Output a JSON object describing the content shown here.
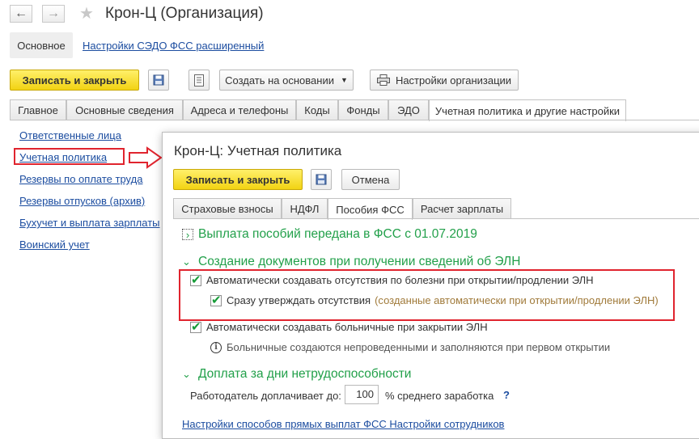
{
  "window": {
    "title": "Крон-Ц (Организация)",
    "back_icon": "arrow-left-icon",
    "forward_icon": "arrow-right-icon",
    "favorite_icon": "star-icon"
  },
  "subtabs": {
    "main_label": "Основное",
    "settings_link": "Настройки СЭДО ФСС расширенный"
  },
  "toolbar": {
    "save_close": "Записать и закрыть",
    "create_based": "Создать на основании",
    "org_settings": "Настройки организации"
  },
  "tabs": [
    {
      "label": "Главное"
    },
    {
      "label": "Основные сведения"
    },
    {
      "label": "Адреса и телефоны"
    },
    {
      "label": "Коды"
    },
    {
      "label": "Фонды"
    },
    {
      "label": "ЭДО"
    },
    {
      "label": "Учетная политика и другие настройки"
    }
  ],
  "left_nav": [
    {
      "label": "Ответственные лица"
    },
    {
      "label": "Учетная политика"
    },
    {
      "label": "Резервы по оплате труда"
    },
    {
      "label": "Резервы отпусков (архив)"
    },
    {
      "label": "Бухучет и выплата зарплаты"
    },
    {
      "label": "Воинский учет"
    }
  ],
  "dialog": {
    "title": "Крон-Ц: Учетная политика",
    "save_close": "Записать и закрыть",
    "cancel": "Отмена",
    "tabs": [
      {
        "label": "Страховые взносы"
      },
      {
        "label": "НДФЛ"
      },
      {
        "label": "Пособия ФСС"
      },
      {
        "label": "Расчет зарплаты"
      }
    ],
    "section1": "Выплата пособий передана в ФСС с 01.07.2019",
    "section2": "Создание документов при получении сведений об ЭЛН",
    "cb1_label": "Автоматически создавать отсутствия по болезни при открытии/продлении ЭЛН",
    "cb2_label": "Сразу утверждать отсутствия",
    "cb2_hint": "(созданные автоматически при открытии/продлении ЭЛН)",
    "cb3_label": "Автоматически создавать больничные при закрытии ЭЛН",
    "info_text": "Больничные создаются непроведенными и заполняются при первом открытии",
    "section3": "Доплата за дни нетрудоспособности",
    "employer_label": "Работодатель доплачивает до:",
    "employer_value": "100",
    "employer_suffix": "% среднего заработка",
    "help": "?",
    "bottom_links": "Настройки способов прямых выплат ФСС   Настройки сотрудников"
  },
  "colors": {
    "accent_yellow": "#f2d313",
    "link_blue": "#1c4da0",
    "section_green": "#22a04a",
    "highlight_red": "#e0242e"
  }
}
